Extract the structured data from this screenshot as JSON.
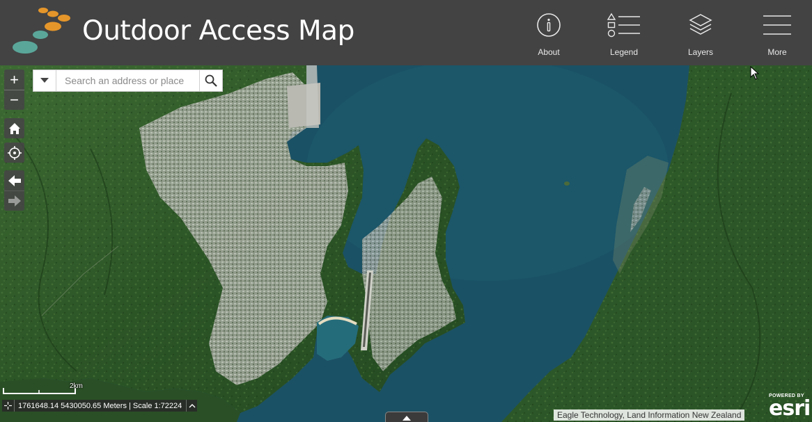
{
  "app": {
    "title": "Outdoor Access Map",
    "logo_colors": [
      "#e5962a",
      "#5aa79a"
    ]
  },
  "header": {
    "background": "#434343",
    "buttons": [
      {
        "label": "About",
        "icon": "info-icon"
      },
      {
        "label": "Legend",
        "icon": "legend-icon"
      },
      {
        "label": "Layers",
        "icon": "layers-icon"
      },
      {
        "label": "More",
        "icon": "menu-icon"
      }
    ]
  },
  "map_controls": {
    "zoom_in": "+",
    "zoom_out": "−",
    "home": "home-icon",
    "locate": "locate-icon",
    "back": "arrow-left-icon",
    "forward": "arrow-right-icon"
  },
  "search": {
    "placeholder": "Search an address or place",
    "value": ""
  },
  "scale": {
    "label": "2km"
  },
  "coordinates": {
    "text": "1761648.14 5430050.65 Meters | Scale 1:72224"
  },
  "attribution": {
    "text": "Eagle Technology, Land Information New Zealand",
    "powered_by": "POWERED BY",
    "esri": "esri"
  },
  "colors": {
    "water": "#1c5466",
    "land": "#2f5a2a",
    "urban": "#9b9f98"
  }
}
